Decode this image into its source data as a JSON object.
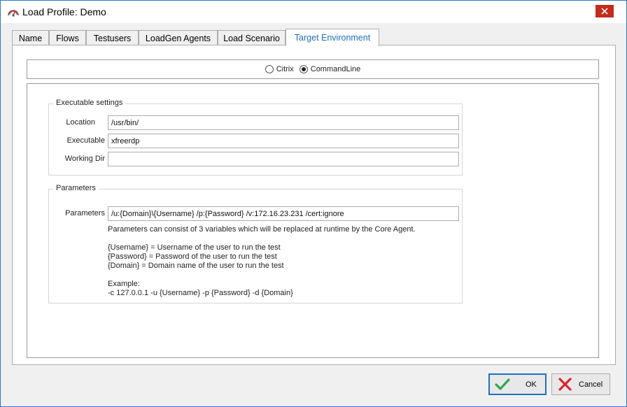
{
  "window": {
    "title": "Load Profile: Demo"
  },
  "tabs": [
    {
      "label": "Name"
    },
    {
      "label": "Flows"
    },
    {
      "label": "Testusers"
    },
    {
      "label": "LoadGen Agents"
    },
    {
      "label": "Load Scenario"
    },
    {
      "label": "Target Environment",
      "active": true
    }
  ],
  "environment": {
    "options": [
      {
        "label": "Citrix",
        "checked": false
      },
      {
        "label": "CommandLine",
        "checked": true
      }
    ]
  },
  "executable_settings": {
    "legend": "Executable settings",
    "location": {
      "label": "Location",
      "value": "/usr/bin/"
    },
    "executable": {
      "label": "Executable",
      "value": "xfreerdp"
    },
    "working_dir": {
      "label": "Working Dir",
      "value": ""
    }
  },
  "parameters": {
    "legend": "Parameters",
    "field": {
      "label": "Parameters",
      "value": "/u:{Domain}\\{Username} /p:{Password} /v:172.16.23.231 /cert:ignore"
    },
    "help": [
      "Parameters can consist of 3 variables which will be replaced at runtime by the Core Agent.",
      "{Username} = Username of the user to run the test",
      "{Password} = Password of the user to run the test",
      "{Domain} = Domain name of the user to run the test",
      "Example:",
      "-c 127.0.0.1 -u {Username} -p {Password} -d {Domain}"
    ]
  },
  "buttons": {
    "ok": "OK",
    "cancel": "Cancel"
  },
  "colors": {
    "accent": "#1f6fbf",
    "close": "#c42b1c",
    "ok_check": "#2fa84f",
    "cancel_x": "#d8262f"
  }
}
